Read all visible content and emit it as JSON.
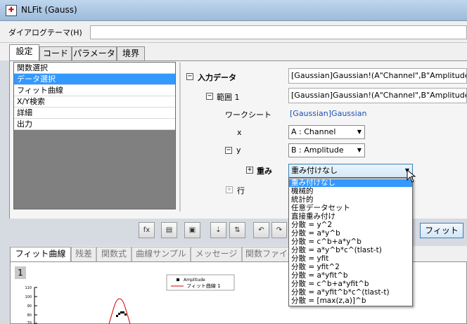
{
  "window": {
    "title": "NLFit (Gauss)"
  },
  "dialog_theme": {
    "label": "ダイアログテーマ(H)"
  },
  "tabs": [
    "設定",
    "コード",
    "パラメータ",
    "境界"
  ],
  "nav": [
    "関数選択",
    "データ選択",
    "フィット曲線",
    "X/Y検索",
    "詳細",
    "出力"
  ],
  "tree": {
    "input_data": "入力データ",
    "input_value": "[Gaussian]Gaussian!(A\"Channel\",B\"Amplitude",
    "range": "範囲 1",
    "range_value": "[Gaussian]Gaussian!(A\"Channel\",B\"Amplitude",
    "worksheet_label": "ワークシート",
    "worksheet_value": "[Gaussian]Gaussian",
    "x_label": "x",
    "x_value": "A : Channel",
    "y_label": "y",
    "y_value": "B : Amplitude",
    "weight_label": "重み",
    "weight_value": "重み付けなし",
    "row_label": "行"
  },
  "weight_options": [
    "重み付けなし",
    "機械的",
    "統計的",
    "任意データセット",
    "直接重み付け",
    "分散 = y^2",
    "分散 = a*y^b",
    "分散 = c^b+a*y^b",
    "分散 = a*y^b*c^(tlast-t)",
    "分散 = yfit",
    "分散 = yfit^2",
    "分散 = a*yfit^b",
    "分散 = c^b+a*yfit^b",
    "分散 = a*yfit^b*c^(tlast-t)",
    "分散 = [max(z,a)]^b"
  ],
  "fit_button": "フィット",
  "bottom_tabs": [
    "フィット曲線",
    "残差",
    "関数式",
    "曲線サンプル",
    "メッセージ",
    "関数ファイ"
  ],
  "preview": {
    "page_number": "1",
    "legend": [
      "Amplitude",
      "フィット曲線 1"
    ],
    "yticks": [
      "110",
      "100",
      "90",
      "80",
      "70"
    ]
  },
  "colors": {
    "selection": "#3399ff",
    "link": "#1a4fb5",
    "fit_curve": "#d40000"
  },
  "icons": [
    "fit-parameter-icon",
    "report-icon",
    "save-icon",
    "sort-icon",
    "swap-icon",
    "undo-icon",
    "redo-icon"
  ]
}
